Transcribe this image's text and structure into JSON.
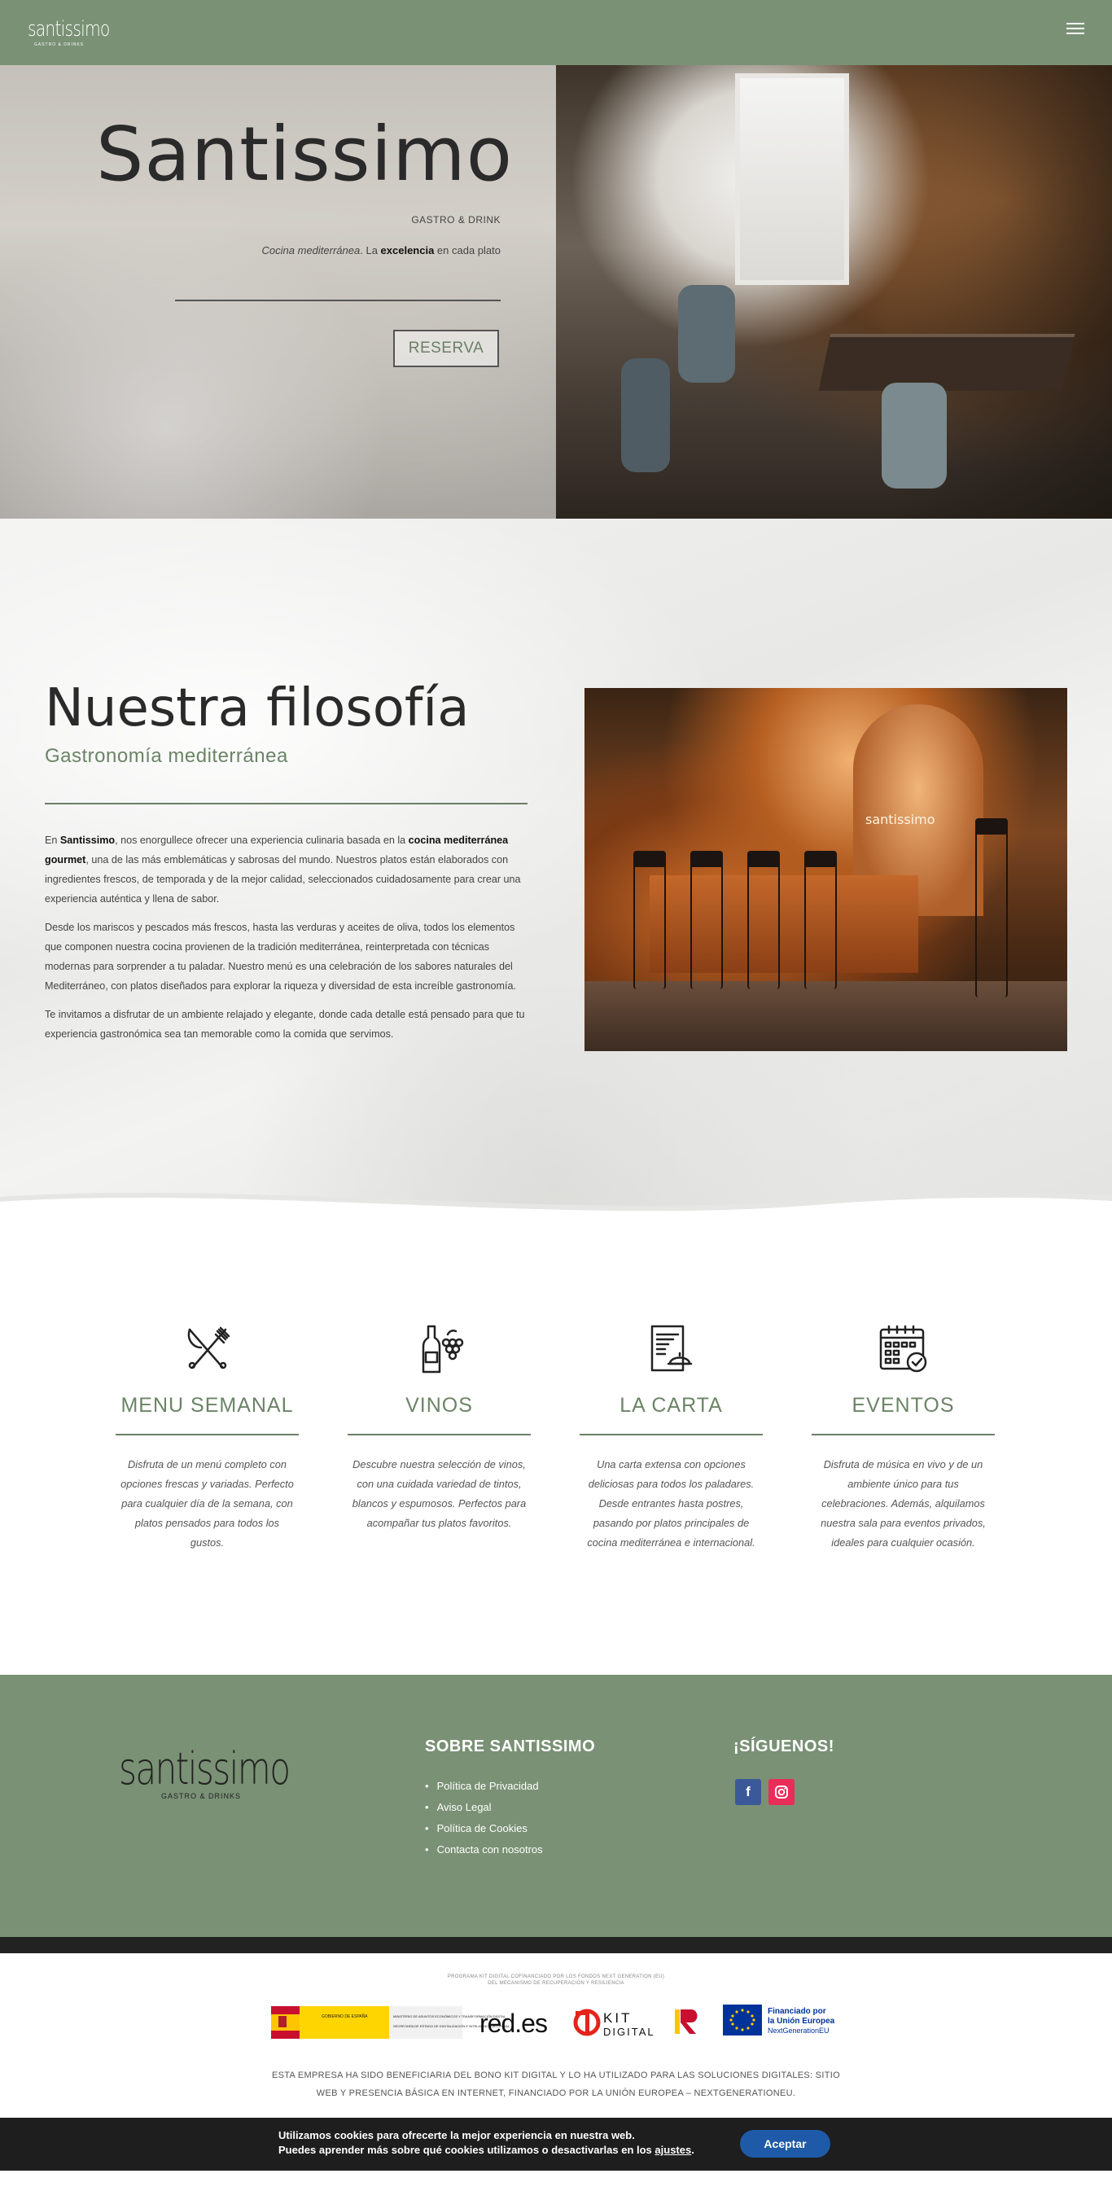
{
  "header": {
    "logo_word": "santissimo",
    "logo_sub": "GASTRO & DRINKS",
    "menu_icon": "hamburger-menu-icon"
  },
  "hero": {
    "title": "Santissimo",
    "tagline": "GASTRO & DRINK",
    "desc_italic": "Cocina mediterránea",
    "desc_mid": ". La ",
    "desc_bold": "excelencia",
    "desc_end": " en cada plato",
    "button": "RESERVA"
  },
  "philosophy": {
    "title": "Nuestra filosofía",
    "subtitle": "Gastronomía mediterránea",
    "p1_a": "En ",
    "p1_brand": "Santissimo",
    "p1_b": ", nos enorgullece ofrecer una experiencia culinaria basada en la ",
    "p1_bold": "cocina mediterránea gourmet",
    "p1_c": ", una de las más emblemáticas y sabrosas del mundo. Nuestros platos están elaborados con ingredientes frescos, de temporada y de la mejor calidad, seleccionados cuidadosamente para crear una experiencia auténtica y llena de sabor.",
    "p2": "Desde los mariscos y pescados más frescos, hasta las verduras y aceites de oliva, todos los elementos que componen nuestra cocina provienen de la tradición mediterránea, reinterpretada con técnicas modernas para sorprender a tu paladar. Nuestro menú es una celebración de los sabores naturales del Mediterráneo, con platos diseñados para explorar la riqueza y diversidad de esta increíble gastronomía.",
    "p3": "Te invitamos a disfrutar de un ambiente relajado y elegante, donde cada detalle está pensado para que tu experiencia gastronómica sea tan memorable como la comida que servimos.",
    "image_sign": "santissimo"
  },
  "features": [
    {
      "icon": "fork-knife-icon",
      "title": "MENU SEMANAL",
      "desc": "Disfruta de un menú completo con opciones frescas y variadas. Perfecto para cualquier día de la semana, con platos pensados para todos los gustos."
    },
    {
      "icon": "wine-bottle-grapes-icon",
      "title": "VINOS",
      "desc": "Descubre nuestra selección de vinos, con una cuidada variedad de tintos, blancos y espumosos. Perfectos para acompañar tus platos favoritos."
    },
    {
      "icon": "menu-document-icon",
      "title": "LA CARTA",
      "desc": "Una carta extensa con opciones deliciosas para todos los paladares. Desde entrantes hasta postres, pasando por platos principales de cocina mediterránea e internacional."
    },
    {
      "icon": "calendar-check-icon",
      "title": "EVENTOS",
      "desc": "Disfruta de música en vivo y de un ambiente único para tus celebraciones. Además, alquilamos nuestra sala para eventos privados, ideales para cualquier ocasión."
    }
  ],
  "footer": {
    "logo_word": "santissimo",
    "logo_sub": "GASTRO & DRINKS",
    "about_title": "SOBRE SANTISSIMO",
    "links": [
      "Política de Privacidad",
      "Aviso Legal",
      "Política de Cookies",
      "Contacta con nosotros"
    ],
    "follow_title": "¡SÍGUENOS!",
    "facebook": "f",
    "instagram_icon": "instagram-icon",
    "facebook_color": "#3b5998",
    "instagram_color": "#ea2c59"
  },
  "kit": {
    "small_line1": "PROGRAMA KIT DIGITAL COFINANCIADO POR LOS FONDOS NEXT GENERATION (EU)",
    "small_line2": "DEL MECANISMO DE RECUPERACIÓN Y RESILIENCIA",
    "gov_title": "GOBIERNO DE ESPAÑA",
    "gov_ministry": "MINISTERIO DE ASUNTOS ECONÓMICOS Y TRANSFORMACIÓN DIGITAL",
    "gov_secretary": "SECRETARÍA DE ESTADO DE DIGITALIZACIÓN E INTELIGENCIA ARTIFICIAL",
    "redes": "red.es",
    "kit_top": "KIT",
    "kit_bottom": "DIGITAL",
    "eu_line1": "Financiado por",
    "eu_line2": "la Unión Europea",
    "eu_line3": "NextGenerationEU",
    "note_line1": "ESTA EMPRESA HA SIDO BENEFICIARIA DEL BONO KIT DIGITAL Y LO HA UTILIZADO PARA LAS SOLUCIONES DIGITALES: SITIO",
    "note_line2": "WEB Y PRESENCIA BÁSICA EN INTERNET, FINANCIADO POR LA UNIÓN EUROPEA – NEXTGENERATIONEU."
  },
  "cookie": {
    "line1": "Utilizamos cookies para ofrecerte la mejor experiencia en nuestra web.",
    "line2_a": "Puedes aprender más sobre qué cookies utilizamos o desactivarlas en los ",
    "line2_link": "ajustes",
    "line2_b": ".",
    "button": "Aceptar"
  },
  "colors": {
    "brand_green": "#7a9175",
    "accent_green": "#6b8466",
    "cookie_button": "#1e5aa8"
  }
}
